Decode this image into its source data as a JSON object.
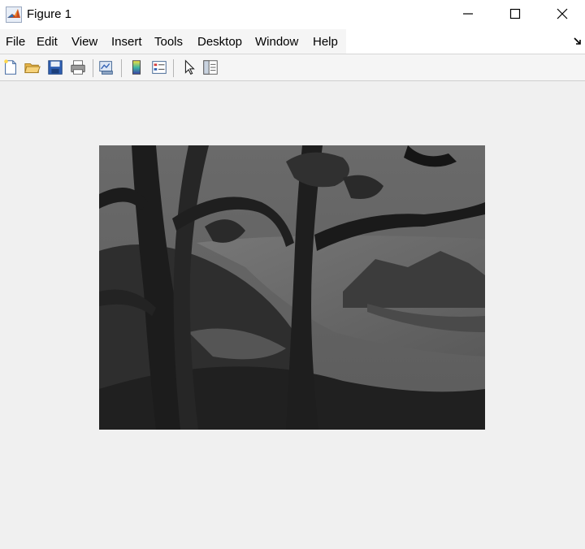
{
  "window": {
    "title": "Figure 1",
    "icon": "matlab-icon",
    "controls": [
      "minimize-icon",
      "maximize-icon",
      "close-icon"
    ]
  },
  "menu": {
    "items": [
      {
        "label": "File"
      },
      {
        "label": "Edit"
      },
      {
        "label": "View"
      },
      {
        "label": "Insert"
      },
      {
        "label": "Tools"
      },
      {
        "label": "Desktop"
      },
      {
        "label": "Window"
      },
      {
        "label": "Help"
      }
    ],
    "dock_icon": "dock-arrow-icon"
  },
  "toolbar": {
    "buttons": [
      {
        "name": "new-figure-icon"
      },
      {
        "name": "open-file-icon"
      },
      {
        "name": "save-figure-icon"
      },
      {
        "name": "print-figure-icon"
      },
      {
        "name": "link-plot-icon"
      },
      {
        "name": "insert-colorbar-icon"
      },
      {
        "name": "insert-legend-icon"
      },
      {
        "name": "edit-plot-icon"
      },
      {
        "name": "open-property-inspector-icon"
      }
    ]
  },
  "figure": {
    "image_description": "grayscale painting of tree with river and mountains"
  }
}
